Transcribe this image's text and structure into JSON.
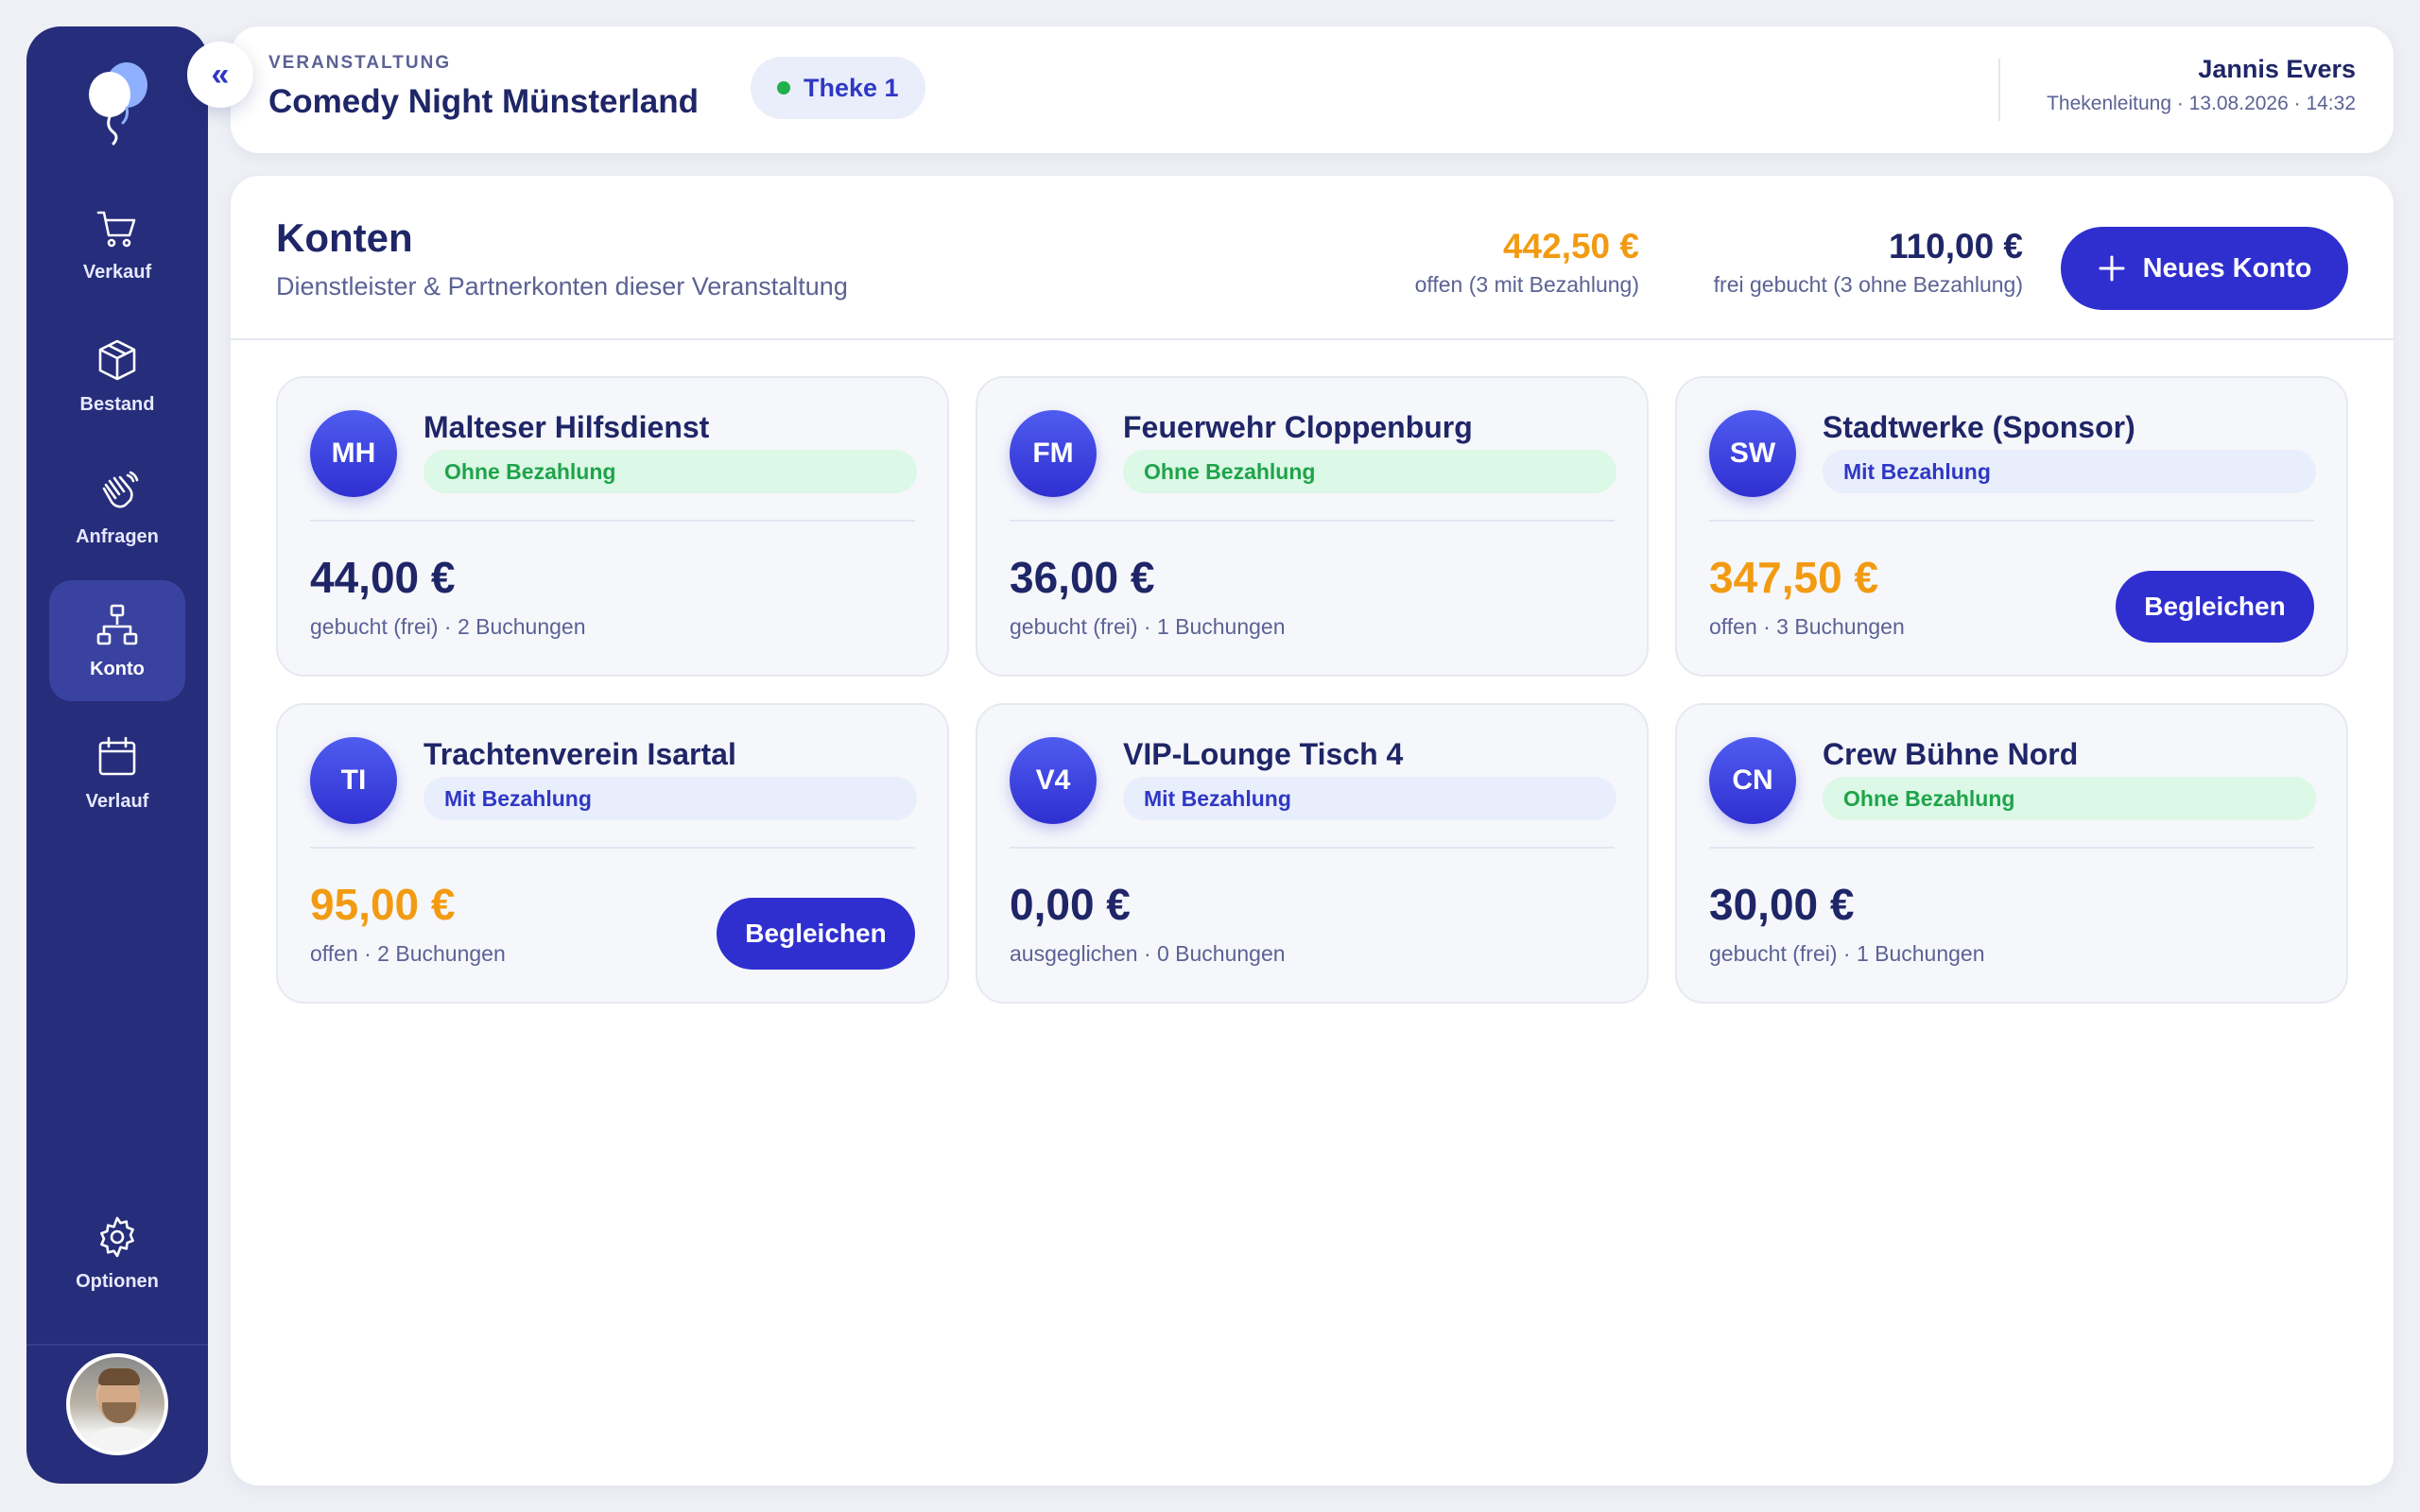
{
  "sidebar": {
    "collapse_icon": "«",
    "items": [
      {
        "label": "Verkauf",
        "icon": "cart-icon",
        "active": false
      },
      {
        "label": "Bestand",
        "icon": "box-icon",
        "active": false
      },
      {
        "label": "Anfragen",
        "icon": "hands-icon",
        "active": false
      },
      {
        "label": "Konto",
        "icon": "network-icon",
        "active": true
      },
      {
        "label": "Verlauf",
        "icon": "calendar-icon",
        "active": false
      }
    ],
    "options_label": "Optionen"
  },
  "header": {
    "event_label": "VERANSTALTUNG",
    "event_title": "Comedy Night Münsterland",
    "counter": "Theke 1",
    "user_name": "Jannis Evers",
    "user_meta": "Thekenleitung · 13.08.2026 · 14:32"
  },
  "main": {
    "title": "Konten",
    "subtitle": "Dienstleister & Partnerkonten dieser Veranstaltung",
    "stat_open_value": "442,50 €",
    "stat_open_label": "offen (3 mit Bezahlung)",
    "stat_free_value": "110,00 €",
    "stat_free_label": "frei gebucht (3 ohne Bezahlung)",
    "new_button": "Neues Konto"
  },
  "accounts": [
    {
      "initials": "MH",
      "name": "Malteser Hilfsdienst",
      "badge": "Ohne Bezahlung",
      "amount": "44,00 €",
      "meta": "gebucht (frei) · 2 Buchungen",
      "settle": ""
    },
    {
      "initials": "FM",
      "name": "Feuerwehr Cloppenburg",
      "badge": "Ohne Bezahlung",
      "amount": "36,00 €",
      "meta": "gebucht (frei) · 1 Buchungen",
      "settle": ""
    },
    {
      "initials": "SW",
      "name": "Stadtwerke (Sponsor)",
      "badge": "Mit Bezahlung",
      "amount": "347,50 €",
      "meta": "offen · 3 Buchungen",
      "settle": "Begleichen"
    },
    {
      "initials": "TI",
      "name": "Trachtenverein Isartal",
      "badge": "Mit Bezahlung",
      "amount": "95,00 €",
      "meta": "offen · 2 Buchungen",
      "settle": "Begleichen"
    },
    {
      "initials": "V4",
      "name": "VIP-Lounge Tisch 4",
      "badge": "Mit Bezahlung",
      "amount": "0,00 €",
      "meta": "ausgeglichen · 0 Buchungen",
      "settle": ""
    },
    {
      "initials": "CN",
      "name": "Crew Bühne Nord",
      "badge": "Ohne Bezahlung",
      "amount": "30,00 €",
      "meta": "gebucht (frei) · 1 Buchungen",
      "settle": ""
    }
  ],
  "colors": {
    "sidebar": "#262d7a",
    "accent": "#2f2fd0",
    "open_amount": "#f29b12",
    "free_badge": "#1ea44a"
  }
}
